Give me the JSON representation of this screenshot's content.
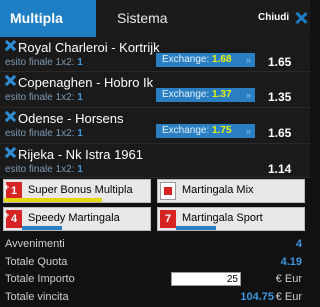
{
  "tabs": {
    "multipla": "Multipla",
    "sistema": "Sistema",
    "close_label": "Chiudi"
  },
  "bets": [
    {
      "match": "Royal Charleroi - Kortrijk",
      "esito_label": "esito finale 1x2:",
      "esito_value": "1",
      "exchange_label": "Exchange:",
      "exchange_value": "1.68",
      "exchange_star": "»",
      "odd": "1.65"
    },
    {
      "match": "Copenaghen - Hobro Ik",
      "esito_label": "esito finale 1x2:",
      "esito_value": "1",
      "exchange_label": "Exchange:",
      "exchange_value": "1.37",
      "exchange_star": "»",
      "odd": "1.35"
    },
    {
      "match": "Odense - Horsens",
      "esito_label": "esito finale 1x2:",
      "esito_value": "1",
      "exchange_label": "Exchange:",
      "exchange_value": "1.75",
      "exchange_star": "»",
      "odd": "1.65"
    },
    {
      "match": "Rijeka - Nk Istra 1961",
      "esito_label": "esito finale 1x2:",
      "esito_value": "1",
      "odd": "1.14"
    }
  ],
  "bonus": [
    {
      "label": "Super Bonus Multipla",
      "badge": "1",
      "plus": "+",
      "bar_color": "#e6d70c"
    },
    {
      "label": "Martingala Mix",
      "badge": "",
      "bar_color": "#d62424"
    },
    {
      "label": "Speedy Martingala",
      "badge": "4",
      "plus": "+",
      "bar_color": "#2a7fc2"
    },
    {
      "label": "Martingala Sport",
      "badge": "7",
      "plus": "",
      "bar_color": "#2a7fc2"
    }
  ],
  "summary": {
    "avvenimenti_label": "Avvenimenti",
    "avvenimenti_value": "4",
    "quota_label": "Totale Quota",
    "quota_value": "4.19",
    "importo_label": "Totale Importo",
    "importo_value": "25",
    "importo_currency": "€ Eur",
    "vincita_label": "Totale vincita",
    "vincita_value": "104.75",
    "vincita_currency": "€ Eur"
  },
  "colors": {
    "accent": "#1e7ec4",
    "exchange_value": "#e8f20a",
    "badge": "#d62424"
  },
  "icons": {
    "remove": "close-icon",
    "close": "close-icon"
  }
}
